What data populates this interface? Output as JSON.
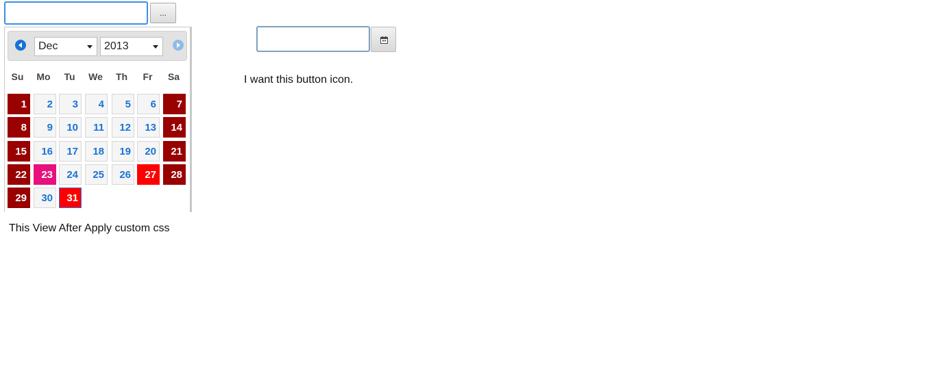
{
  "left_widget": {
    "date_input": {
      "value": "",
      "placeholder": ""
    },
    "open_button_label": "..."
  },
  "datepicker": {
    "prev_icon": "prev-arrow-icon",
    "next_icon": "next-arrow-icon",
    "month_selected": "Dec",
    "year_selected": "2013",
    "weekdays": [
      "Su",
      "Mo",
      "Tu",
      "We",
      "Th",
      "Fr",
      "Sa"
    ],
    "weeks": [
      [
        {
          "d": "1",
          "t": "weekend"
        },
        {
          "d": "2",
          "t": ""
        },
        {
          "d": "3",
          "t": ""
        },
        {
          "d": "4",
          "t": ""
        },
        {
          "d": "5",
          "t": ""
        },
        {
          "d": "6",
          "t": ""
        },
        {
          "d": "7",
          "t": "weekend"
        }
      ],
      [
        {
          "d": "8",
          "t": "weekend"
        },
        {
          "d": "9",
          "t": ""
        },
        {
          "d": "10",
          "t": ""
        },
        {
          "d": "11",
          "t": ""
        },
        {
          "d": "12",
          "t": ""
        },
        {
          "d": "13",
          "t": ""
        },
        {
          "d": "14",
          "t": "weekend"
        }
      ],
      [
        {
          "d": "15",
          "t": "weekend"
        },
        {
          "d": "16",
          "t": ""
        },
        {
          "d": "17",
          "t": ""
        },
        {
          "d": "18",
          "t": ""
        },
        {
          "d": "19",
          "t": ""
        },
        {
          "d": "20",
          "t": ""
        },
        {
          "d": "21",
          "t": "weekend"
        }
      ],
      [
        {
          "d": "22",
          "t": "weekend"
        },
        {
          "d": "23",
          "t": "today"
        },
        {
          "d": "24",
          "t": ""
        },
        {
          "d": "25",
          "t": ""
        },
        {
          "d": "26",
          "t": ""
        },
        {
          "d": "27",
          "t": "holiday"
        },
        {
          "d": "28",
          "t": "weekend"
        }
      ],
      [
        {
          "d": "29",
          "t": "weekend"
        },
        {
          "d": "30",
          "t": ""
        },
        {
          "d": "31",
          "t": "selected"
        }
      ]
    ],
    "colors": {
      "weekend": "#990000",
      "today": "#e8107c",
      "holiday": "#ff0000",
      "weekday_text": "#1a73d6"
    }
  },
  "captions": {
    "left": "This View After Apply custom css",
    "right": "I want this button icon."
  },
  "right_widget": {
    "date_input": {
      "value": "",
      "placeholder": ""
    },
    "button_icon": "calendar-icon"
  }
}
